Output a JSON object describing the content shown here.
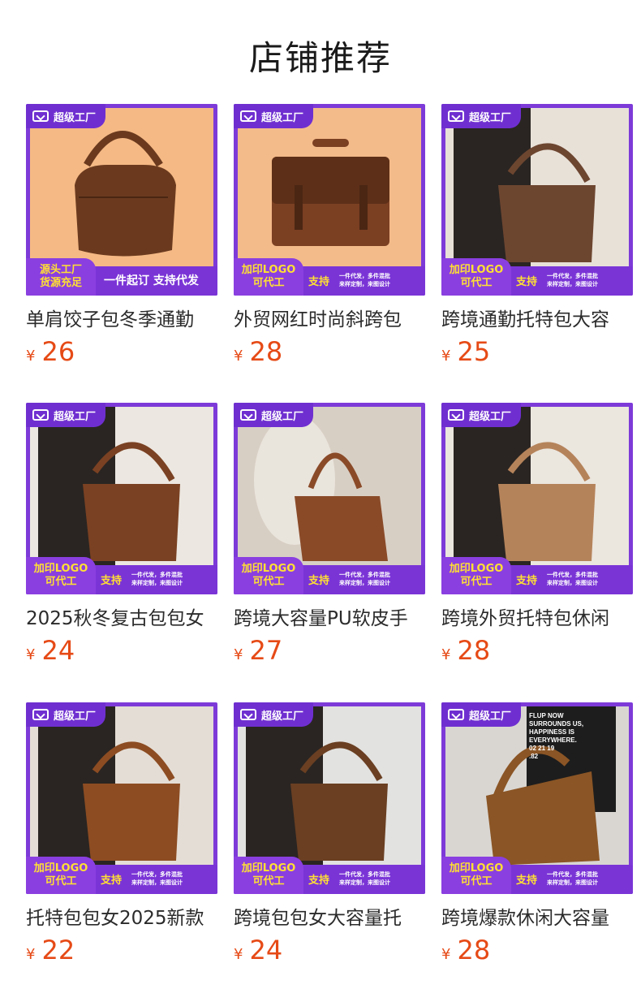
{
  "page_title": "店铺推荐",
  "badge_label": "超级工厂",
  "colors": {
    "accent_purple": "#7a34d6",
    "price_orange": "#e64a16",
    "badge_yellow": "#ffe033"
  },
  "products": [
    {
      "name": "单肩饺子包冬季通勤",
      "currency": "¥",
      "price": "26",
      "bar_left_1": "源头工厂",
      "bar_left_2": "货源充足",
      "bar_slogan": "一件起订 支持代发",
      "bar_support": "",
      "bar_tiny_1": "",
      "bar_tiny_2": "",
      "photo_bg": "#f5b985",
      "bag_color": "#6b3a1e"
    },
    {
      "name": "外贸网红时尚斜跨包",
      "currency": "¥",
      "price": "28",
      "bar_left_1": "加印LOGO",
      "bar_left_2": "可代工",
      "bar_slogan": "",
      "bar_support": "支持",
      "bar_tiny_1": "一件代发，多件混批",
      "bar_tiny_2": "来样定制，来图设计",
      "photo_bg": "#f4bb8a",
      "bag_color": "#7b3f22"
    },
    {
      "name": "跨境通勤托特包大容",
      "currency": "¥",
      "price": "25",
      "bar_left_1": "加印LOGO",
      "bar_left_2": "可代工",
      "bar_slogan": "",
      "bar_support": "支持",
      "bar_tiny_1": "一件代发，多件混批",
      "bar_tiny_2": "来样定制，来图设计",
      "photo_bg": "#e8e1d8",
      "bag_color": "#6d4630"
    },
    {
      "name": "2025秋冬复古包包女",
      "currency": "¥",
      "price": "24",
      "bar_left_1": "加印LOGO",
      "bar_left_2": "可代工",
      "bar_slogan": "",
      "bar_support": "支持",
      "bar_tiny_1": "一件代发，多件混批",
      "bar_tiny_2": "来样定制，来图设计",
      "photo_bg": "#ece7e0",
      "bag_color": "#7a4122"
    },
    {
      "name": "跨境大容量PU软皮手",
      "currency": "¥",
      "price": "27",
      "bar_left_1": "加印LOGO",
      "bar_left_2": "可代工",
      "bar_slogan": "",
      "bar_support": "支持",
      "bar_tiny_1": "一件代发，多件混批",
      "bar_tiny_2": "来样定制，来图设计",
      "photo_bg": "#d8cfc4",
      "bag_color": "#8a4a28"
    },
    {
      "name": "跨境外贸托特包休闲",
      "currency": "¥",
      "price": "28",
      "bar_left_1": "加印LOGO",
      "bar_left_2": "可代工",
      "bar_slogan": "",
      "bar_support": "支持",
      "bar_tiny_1": "一件代发，多件混批",
      "bar_tiny_2": "来样定制，来图设计",
      "photo_bg": "#ebe6de",
      "bag_color": "#b5835a"
    },
    {
      "name": "托特包包女2025新款",
      "currency": "¥",
      "price": "22",
      "bar_left_1": "加印LOGO",
      "bar_left_2": "可代工",
      "bar_slogan": "",
      "bar_support": "支持",
      "bar_tiny_1": "一件代发，多件混批",
      "bar_tiny_2": "来样定制，来图设计",
      "photo_bg": "#e4ddd5",
      "bag_color": "#8d4c22"
    },
    {
      "name": "跨境包包女大容量托",
      "currency": "¥",
      "price": "24",
      "bar_left_1": "加印LOGO",
      "bar_left_2": "可代工",
      "bar_slogan": "",
      "bar_support": "支持",
      "bar_tiny_1": "一件代发，多件混批",
      "bar_tiny_2": "来样定制，来图设计",
      "photo_bg": "#e2e2e0",
      "bag_color": "#6a3f22"
    },
    {
      "name": "跨境爆款休闲大容量",
      "currency": "¥",
      "price": "28",
      "bar_left_1": "加印LOGO",
      "bar_left_2": "可代工",
      "bar_slogan": "",
      "bar_support": "支持",
      "bar_tiny_1": "一件代发，多件混批",
      "bar_tiny_2": "来样定制，来图设计",
      "photo_bg": "#d9d6d2",
      "bag_color": "#8b5525"
    }
  ],
  "poster_text": [
    "FLUP NOW",
    "SURROUNDS US,",
    "HAPPINESS IS",
    "EVERYWHERE.",
    "02 21 19",
    ".82"
  ]
}
